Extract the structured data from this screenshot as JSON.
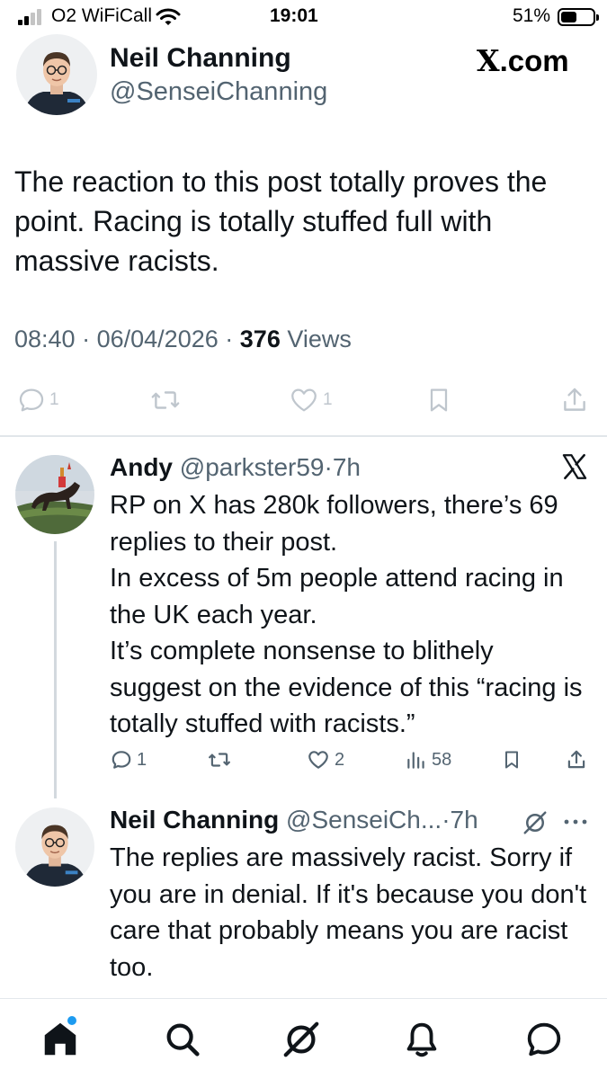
{
  "status_bar": {
    "carrier": "O2 WiFiCall",
    "time": "19:01",
    "battery": "51%"
  },
  "post": {
    "author_name": "Neil Channing",
    "author_handle": "@SenseiChanning",
    "site_label": ".com",
    "site_mark": "X",
    "text": "The reaction to this post totally proves the point. Racing is totally stuffed full with massive racists.",
    "time": "08:40",
    "date": "06/04/2026",
    "views_count": "376",
    "views_label": "Views",
    "separator": "·",
    "reply_count": "1",
    "like_count": "1"
  },
  "replies": [
    {
      "name": "Andy",
      "handle": "@parkster59",
      "age": "7h",
      "separator": "·",
      "text": "RP on X has 280k followers, there’s 69 replies to their post.\nIn excess of 5m people attend racing in the UK each year.\nIt’s complete nonsense to blithely suggest on the evidence of this “racing is totally stuffed with racists.”",
      "reply_count": "1",
      "like_count": "2",
      "views": "58",
      "badge_icon": "x-logo-icon"
    },
    {
      "name": "Neil Channing",
      "handle": "@SenseiCh...",
      "age": "7h",
      "separator": "·",
      "text": "The replies are massively racist. Sorry if you are in denial. If it's because you don't care that probably means you are racist too."
    }
  ],
  "colors": {
    "text": "#0f1419",
    "secondary": "#536471",
    "accent": "#1d9bf0"
  },
  "bottom_nav": [
    "home-icon",
    "search-icon",
    "grok-icon",
    "notifications-icon",
    "messages-icon"
  ]
}
